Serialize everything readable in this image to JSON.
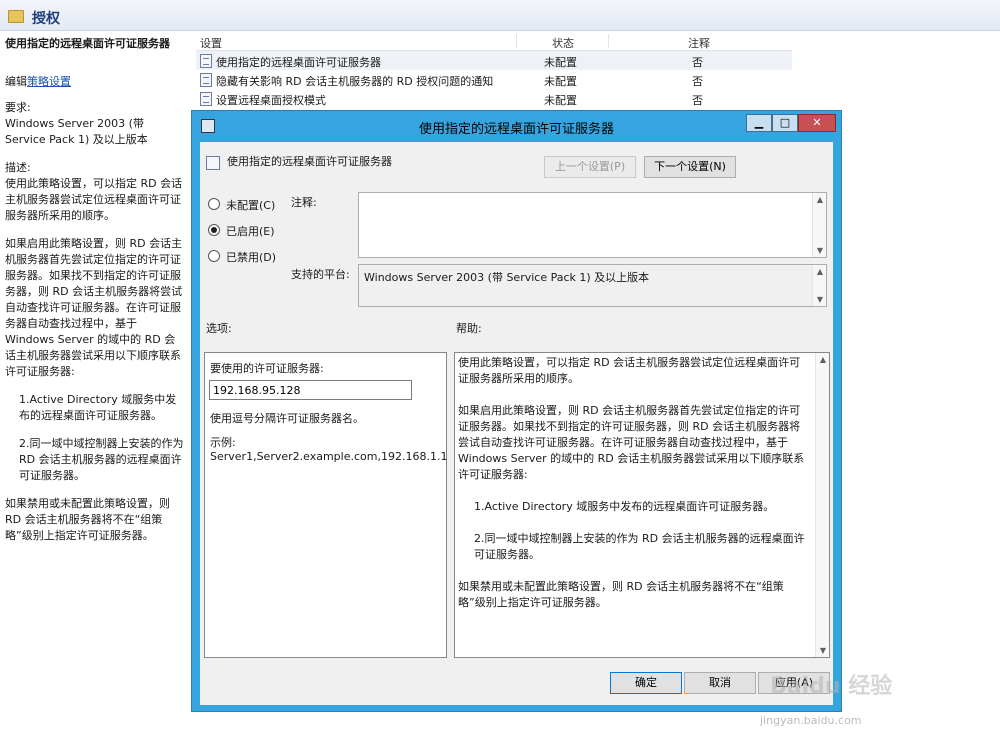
{
  "editor": {
    "folder_title": "授权",
    "left_pane": {
      "title": "使用指定的远程桌面许可证服务器",
      "edit_prefix": "编辑",
      "edit_link": "策略设置",
      "requirements_label": "要求:",
      "requirements_text": "Windows Server 2003 (带 Service Pack 1) 及以上版本",
      "description_label": "描述:",
      "paragraphs": [
        "使用此策略设置，可以指定 RD 会话主机服务器尝试定位远程桌面许可证服务器所采用的顺序。",
        "如果启用此策略设置，则 RD 会话主机服务器首先尝试定位指定的许可证服务器。如果找不到指定的许可证服务器，则 RD 会话主机服务器将尝试自动查找许可证服务器。在许可证服务器自动查找过程中，基于 Windows Server 的域中的 RD 会话主机服务器尝试采用以下顺序联系许可证服务器:",
        "1.Active Directory 域服务中发布的远程桌面许可证服务器。",
        "2.同一域中域控制器上安装的作为 RD 会话主机服务器的远程桌面许可证服务器。",
        "如果禁用或未配置此策略设置，则 RD 会话主机服务器将不在“组策略”级别上指定许可证服务器。"
      ]
    },
    "list": {
      "columns": [
        "设置",
        "状态",
        "注释"
      ],
      "rows": [
        {
          "name": "使用指定的远程桌面许可证服务器",
          "state": "未配置",
          "note": "否"
        },
        {
          "name": "隐藏有关影响 RD 会话主机服务器的 RD 授权问题的通知",
          "state": "未配置",
          "note": "否"
        },
        {
          "name": "设置远程桌面授权模式",
          "state": "未配置",
          "note": "否"
        }
      ]
    }
  },
  "dialog": {
    "title": "使用指定的远程桌面许可证服务器",
    "window_buttons": {
      "minimize": "▁",
      "maximize": "□",
      "close": "✕"
    },
    "header_title": "使用指定的远程桌面许可证服务器",
    "prev_button": "上一个设置(P)",
    "next_button": "下一个设置(N)",
    "radio": {
      "not_configured": "未配置(C)",
      "enabled": "已启用(E)",
      "disabled": "已禁用(D)",
      "selected": "enabled"
    },
    "comment_label": "注释:",
    "comment_value": "",
    "platform_label": "支持的平台:",
    "platform_value": "Windows Server 2003 (带 Service Pack 1) 及以上版本",
    "options_label": "选项:",
    "help_label": "帮助:",
    "options": {
      "server_label": "要使用的许可证服务器:",
      "server_value": "192.168.95.128",
      "hint": "使用逗号分隔许可证服务器名。",
      "example_label": "示例:",
      "example_value": "Server1,Server2.example.com,192.168.1.1"
    },
    "help_paragraphs": [
      "使用此策略设置，可以指定 RD 会话主机服务器尝试定位远程桌面许可证服务器所采用的顺序。",
      "如果启用此策略设置，则 RD 会话主机服务器首先尝试定位指定的许可证服务器。如果找不到指定的许可证服务器，则 RD 会话主机服务器将尝试自动查找许可证服务器。在许可证服务器自动查找过程中，基于 Windows Server 的域中的 RD 会话主机服务器尝试采用以下顺序联系许可证服务器:",
      "1.Active Directory 域服务中发布的远程桌面许可证服务器。",
      "2.同一域中域控制器上安装的作为 RD 会话主机服务器的远程桌面许可证服务器。",
      "如果禁用或未配置此策略设置，则 RD 会话主机服务器将不在“组策略”级别上指定许可证服务器。"
    ],
    "ok_button": "确定",
    "cancel_button": "取消",
    "apply_button": "应用(A)"
  },
  "watermark": {
    "brand": "Baidu 经验",
    "url": "jingyan.baidu.com"
  },
  "colors": {
    "titlebar": "#36a4de",
    "dialog_bg": "#f0f0f0",
    "link": "#1a4fb5"
  }
}
